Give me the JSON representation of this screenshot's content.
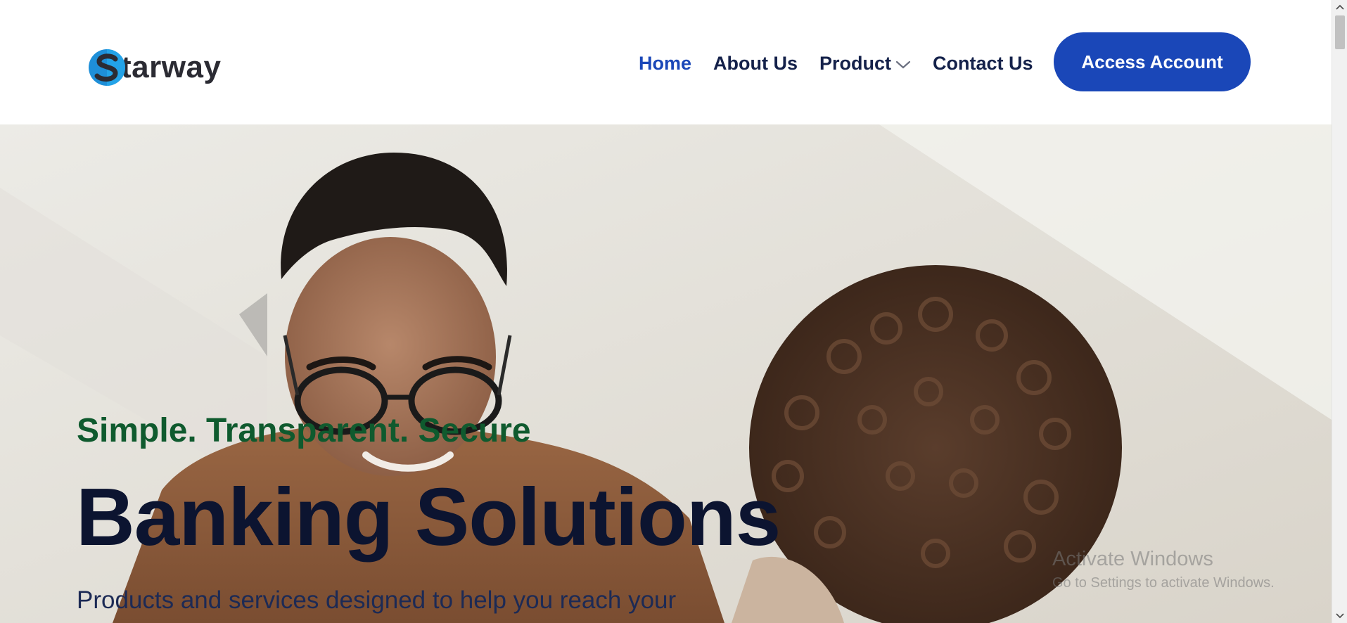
{
  "brand": {
    "logo_letter": "S",
    "logo_text": "tarway",
    "colors": {
      "mark_blue": "#1e8fd8",
      "mark_dark": "#2b2b33"
    }
  },
  "nav": {
    "items": [
      {
        "label": "Home",
        "active": true
      },
      {
        "label": "About Us",
        "active": false
      },
      {
        "label": "Product",
        "active": false,
        "has_dropdown": true
      },
      {
        "label": "Contact Us",
        "active": false
      }
    ],
    "cta_label": "Access Account"
  },
  "hero": {
    "tagline": "Simple. Transparent. Secure",
    "title": "Banking Solutions",
    "subtitle": "Products and services designed to help you reach your"
  },
  "os_watermark": {
    "title": "Activate Windows",
    "subtitle": "Go to Settings to activate Windows."
  },
  "colors": {
    "accent": "#1a47b8",
    "nav_text": "#14214a",
    "tagline": "#0f5a2e",
    "title": "#0c1430"
  },
  "icons": {
    "dropdown": "chevron-down-icon",
    "scroll_up": "chevron-up-icon",
    "scroll_down": "chevron-down-icon"
  }
}
